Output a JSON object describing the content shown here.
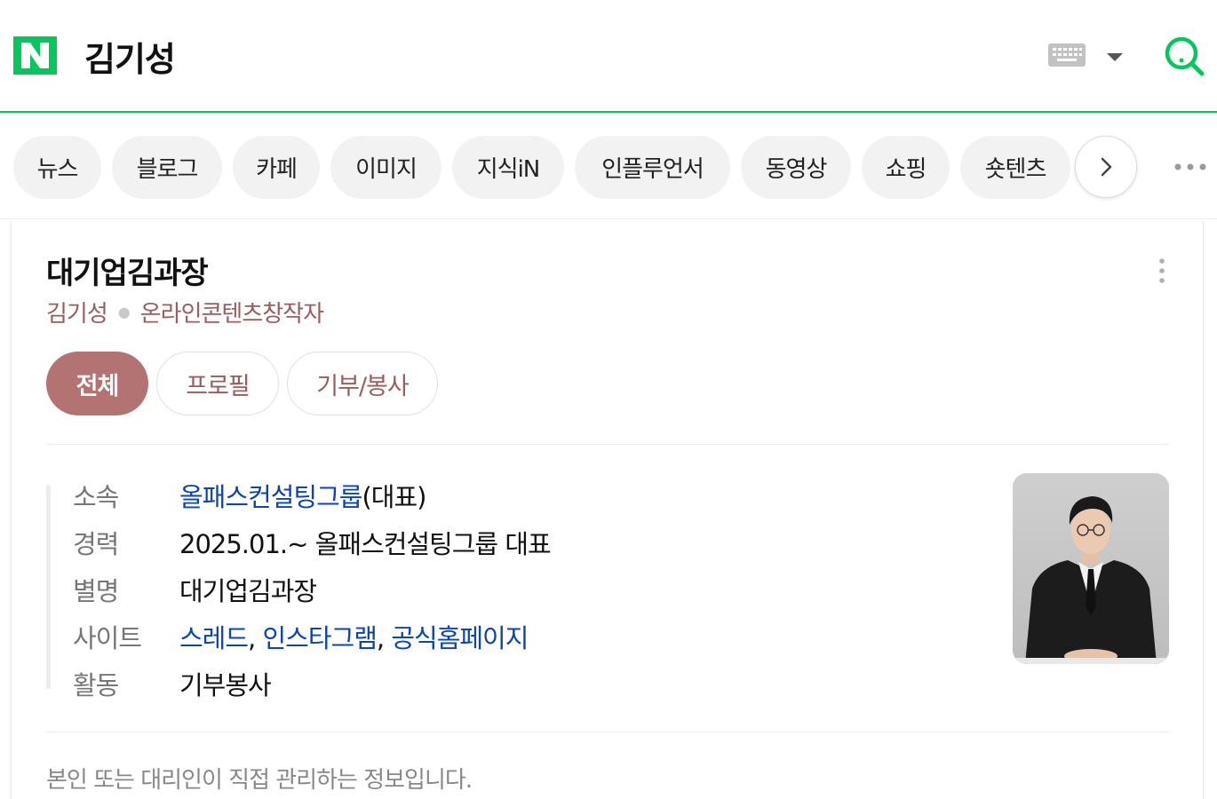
{
  "header": {
    "logo_label": "N",
    "query": "김기성"
  },
  "tabs": [
    {
      "label": "뉴스"
    },
    {
      "label": "블로그"
    },
    {
      "label": "카페"
    },
    {
      "label": "이미지"
    },
    {
      "label": "지식iN"
    },
    {
      "label": "인플루언서"
    },
    {
      "label": "동영상"
    },
    {
      "label": "쇼핑"
    },
    {
      "label": "숏텐츠"
    }
  ],
  "card": {
    "title": "대기업김과장",
    "name": "김기성",
    "occupation": "온라인콘텐츠창작자",
    "chips": [
      {
        "label": "전체"
      },
      {
        "label": "프로필"
      },
      {
        "label": "기부/봉사"
      }
    ],
    "info": {
      "affiliation": {
        "label": "소속",
        "link": "올패스컨설팅그룹",
        "suffix": "(대표)"
      },
      "career": {
        "label": "경력",
        "value": "2025.01.~ 올패스컨설팅그룹 대표"
      },
      "alias": {
        "label": "별명",
        "value": "대기업김과장"
      },
      "sites": {
        "label": "사이트",
        "links": [
          "스레드",
          "인스타그램",
          "공식홈페이지"
        ],
        "separator": ", "
      },
      "activity": {
        "label": "활동",
        "link": "기부봉사"
      }
    },
    "footnote": "본인 또는 대리인이 직접 관리하는 정보입니다."
  },
  "colors": {
    "brand_green": "#03c75a",
    "chip_active": "#b47373",
    "accent_text": "#9a5d5d",
    "link": "#0c43b7"
  }
}
